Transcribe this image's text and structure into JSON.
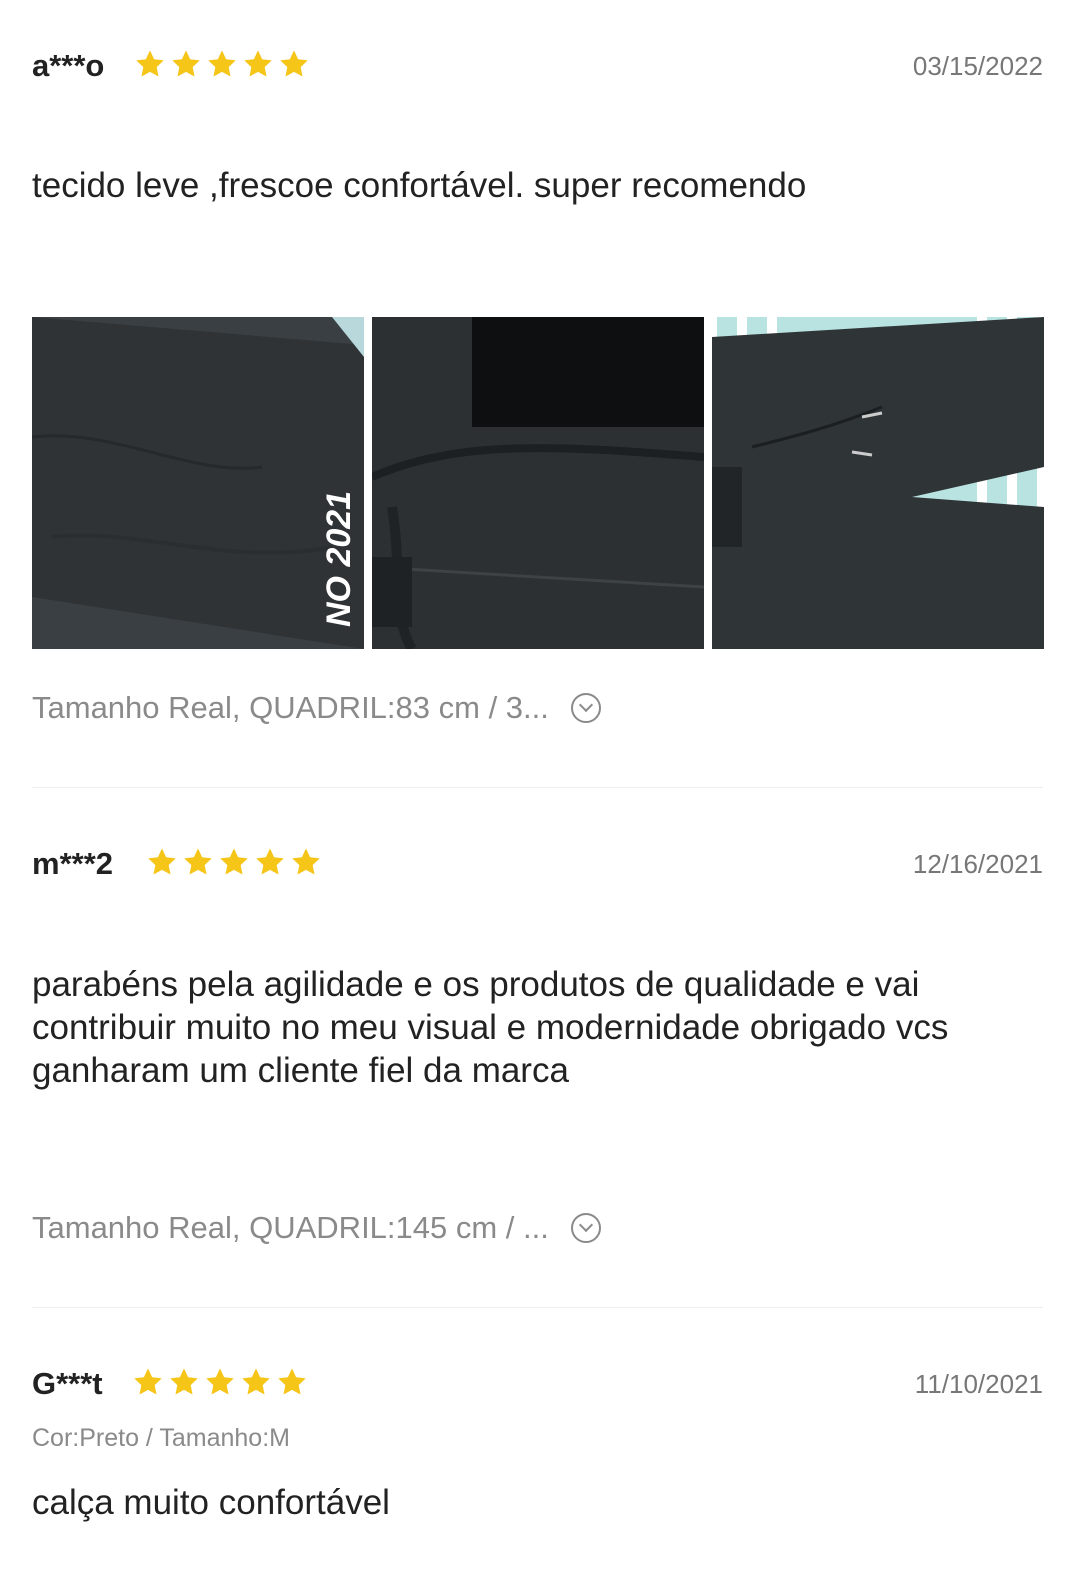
{
  "colors": {
    "star": "#F5C518",
    "date": "#777777",
    "meta": "#8a8a8a"
  },
  "reviews": [
    {
      "user": "a***o",
      "rating": 5,
      "date": "03/15/2022",
      "text": "tecido leve ,frescoe confortável. super recomendo",
      "photo_watermark": "NO 2021",
      "size": "Tamanho Real, QUADRIL:83 cm / 3..."
    },
    {
      "user": "m***2",
      "rating": 5,
      "date": "12/16/2021",
      "text": "parabéns pela agilidade e os produtos de qualidade e vai contribuir muito no meu visual e modernidade obrigado vcs ganharam um cliente fiel da marca",
      "size": "Tamanho Real, QUADRIL:145 cm / ..."
    },
    {
      "user": "G***t",
      "rating": 5,
      "date": "11/10/2021",
      "variant": "Cor:Preto / Tamanho:M",
      "text": "calça muito confortável"
    }
  ],
  "icons": {
    "star": "star-icon",
    "expand": "chevron-down-circle-icon"
  }
}
